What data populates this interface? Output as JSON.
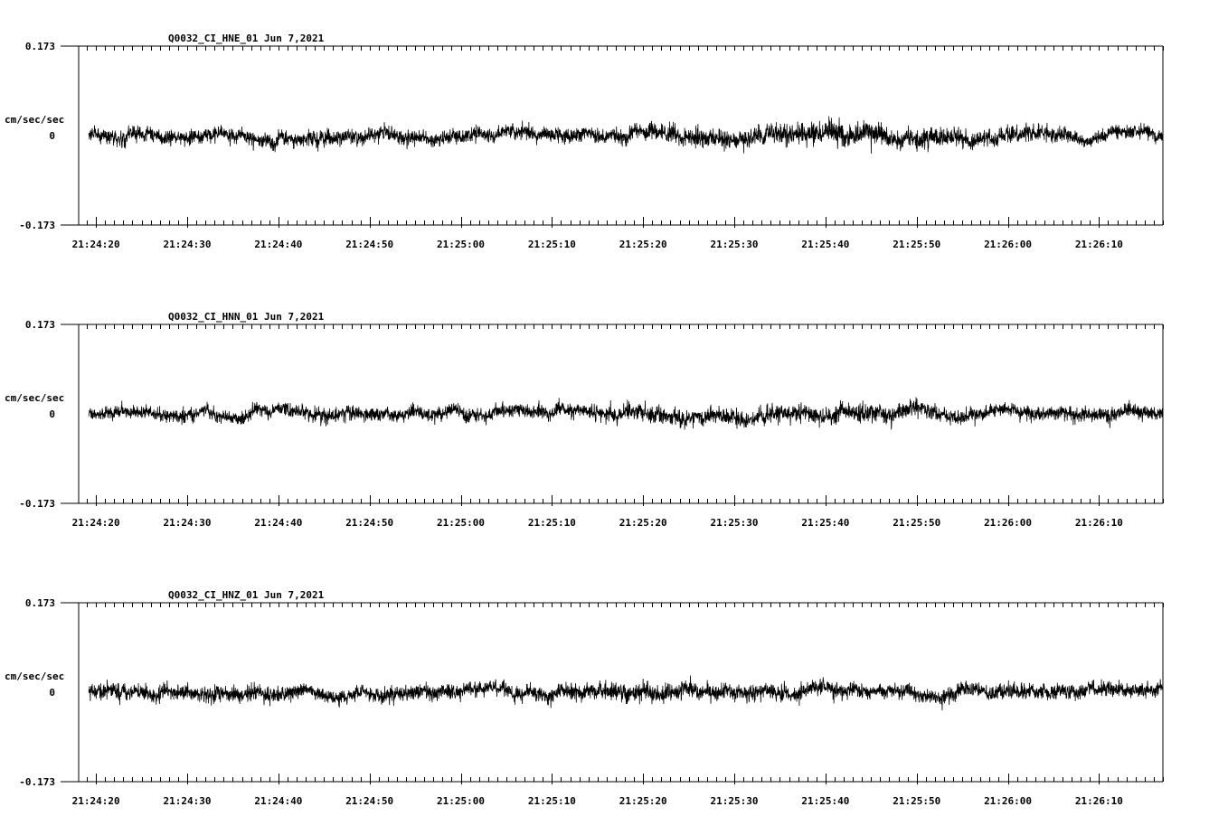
{
  "chart_data": [
    {
      "type": "line",
      "title": "Q0032_CI_HNE_01  Jun 7,2021",
      "ylabel": "cm/sec/sec",
      "ylim": [
        -0.173,
        0.173
      ],
      "y_ticks": [
        "0.173",
        "0",
        "-0.173"
      ],
      "x_ticks": [
        "21:24:20",
        "21:24:30",
        "21:24:40",
        "21:24:50",
        "21:25:00",
        "21:25:10",
        "21:25:20",
        "21:25:30",
        "21:25:40",
        "21:25:50",
        "21:26:00",
        "21:26:10"
      ],
      "xlim": [
        "21:24:18.1",
        "21:26:17.0"
      ],
      "data_start": "21:24:19.2",
      "series": [
        {
          "color": "#000000",
          "envelope_times": [
            "21:24:20",
            "21:24:30",
            "21:24:40",
            "21:24:50",
            "21:25:00",
            "21:25:10",
            "21:25:20",
            "21:25:25",
            "21:25:30",
            "21:25:40",
            "21:25:50",
            "21:26:00",
            "21:26:10",
            "21:26:17"
          ],
          "envelope_amplitude": [
            0.012,
            0.012,
            0.013,
            0.014,
            0.012,
            0.012,
            0.013,
            0.02,
            0.014,
            0.02,
            0.016,
            0.014,
            0.012,
            0.012
          ]
        }
      ]
    },
    {
      "type": "line",
      "title": "Q0032_CI_HNN_01  Jun 7,2021",
      "ylabel": "cm/sec/sec",
      "ylim": [
        -0.173,
        0.173
      ],
      "y_ticks": [
        "0.173",
        "0",
        "-0.173"
      ],
      "x_ticks": [
        "21:24:20",
        "21:24:30",
        "21:24:40",
        "21:24:50",
        "21:25:00",
        "21:25:10",
        "21:25:20",
        "21:25:30",
        "21:25:40",
        "21:25:50",
        "21:26:00",
        "21:26:10"
      ],
      "xlim": [
        "21:24:18.1",
        "21:26:17.0"
      ],
      "data_start": "21:24:19.2",
      "series": [
        {
          "color": "#000000",
          "envelope_times": [
            "21:24:20",
            "21:24:30",
            "21:24:40",
            "21:24:50",
            "21:25:00",
            "21:25:10",
            "21:25:20",
            "21:25:30",
            "21:25:40",
            "21:25:50",
            "21:26:00",
            "21:26:10",
            "21:26:17"
          ],
          "envelope_amplitude": [
            0.011,
            0.011,
            0.012,
            0.012,
            0.012,
            0.012,
            0.014,
            0.013,
            0.016,
            0.014,
            0.012,
            0.012,
            0.012
          ]
        }
      ]
    },
    {
      "type": "line",
      "title": "Q0032_CI_HNZ_01  Jun 7,2021",
      "ylabel": "cm/sec/sec",
      "ylim": [
        -0.173,
        0.173
      ],
      "y_ticks": [
        "0.173",
        "0",
        "-0.173"
      ],
      "x_ticks": [
        "21:24:20",
        "21:24:30",
        "21:24:40",
        "21:24:50",
        "21:25:00",
        "21:25:10",
        "21:25:20",
        "21:25:30",
        "21:25:40",
        "21:25:50",
        "21:26:00",
        "21:26:10"
      ],
      "xlim": [
        "21:24:18.1",
        "21:26:17.0"
      ],
      "data_start": "21:24:19.2",
      "series": [
        {
          "color": "#000000",
          "envelope_times": [
            "21:24:20",
            "21:24:30",
            "21:24:40",
            "21:24:50",
            "21:25:00",
            "21:25:10",
            "21:25:20",
            "21:25:30",
            "21:25:40",
            "21:25:50",
            "21:26:00",
            "21:26:10",
            "21:26:17"
          ],
          "envelope_amplitude": [
            0.014,
            0.013,
            0.013,
            0.012,
            0.013,
            0.012,
            0.016,
            0.013,
            0.013,
            0.012,
            0.014,
            0.013,
            0.013
          ]
        }
      ]
    }
  ]
}
